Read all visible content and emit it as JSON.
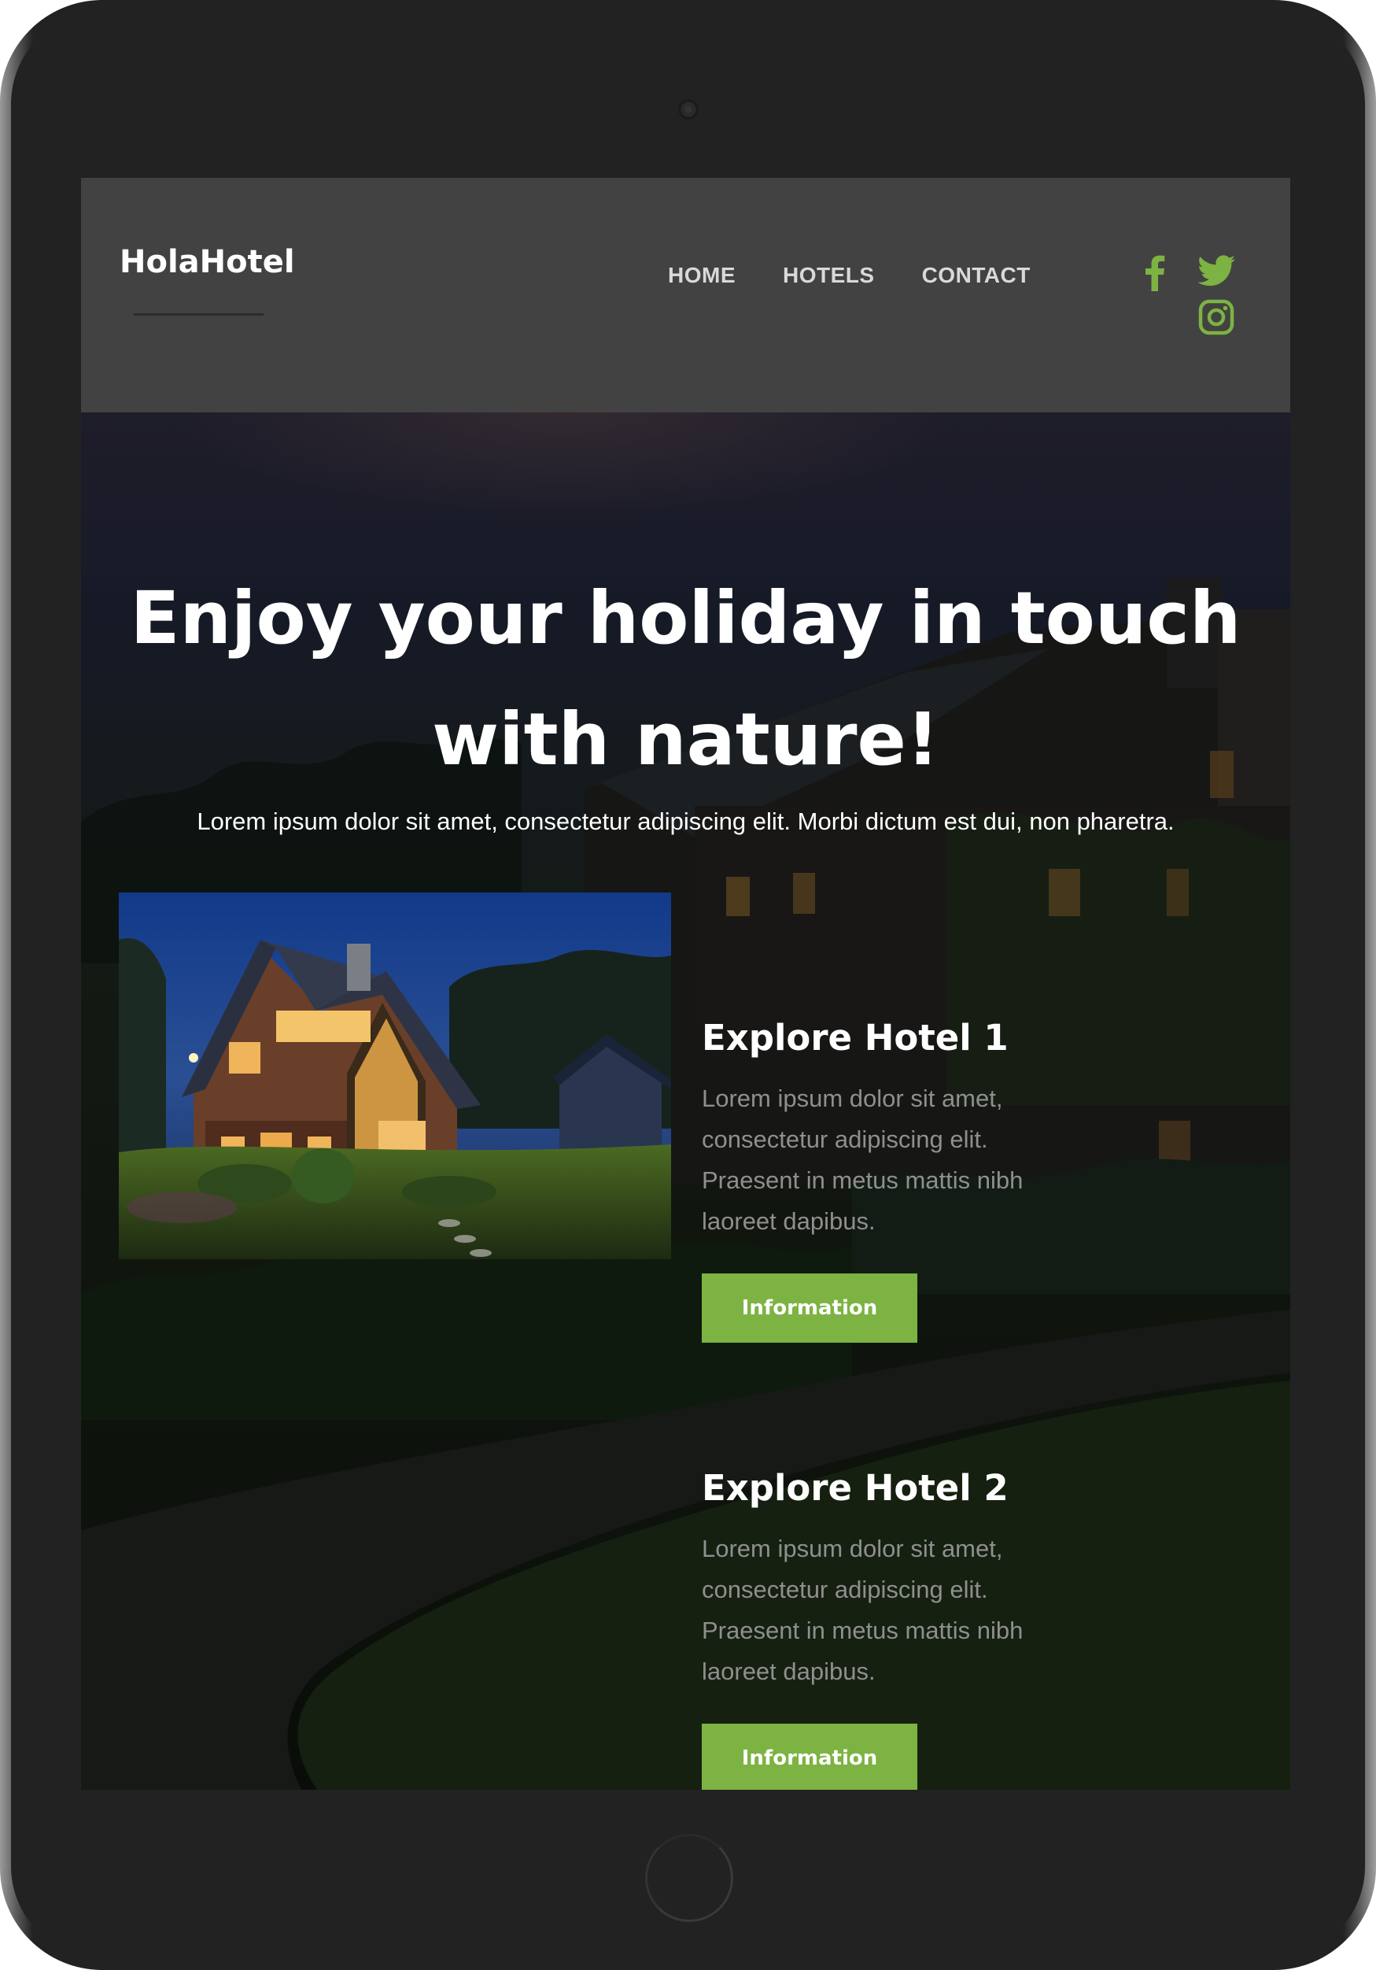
{
  "brand": "HolaHotel",
  "nav": {
    "items": [
      "HOME",
      "HOTELS",
      "CONTACT"
    ]
  },
  "social": {
    "icons": [
      "facebook-icon",
      "twitter-icon",
      "instagram-icon"
    ],
    "color": "#7cb342"
  },
  "hero": {
    "title": "Enjoy your holiday in touch with nature!",
    "subtitle": "Lorem ipsum dolor sit amet, consectetur adipiscing elit. Morbi dictum est dui, non pharetra."
  },
  "hotels": [
    {
      "title": "Explore Hotel 1",
      "text": "Lorem ipsum dolor sit amet, consectetur adipiscing elit. Praesent in metus mattis nibh laoreet dapibus.",
      "button": "Information"
    },
    {
      "title": "Explore Hotel 2",
      "text": "Lorem ipsum dolor sit amet, consectetur adipiscing elit. Praesent in metus mattis nibh laoreet dapibus.",
      "button": "Information"
    }
  ],
  "colors": {
    "accent": "#7cb342",
    "header_bg": "#424242",
    "device_frame": "#222222"
  }
}
